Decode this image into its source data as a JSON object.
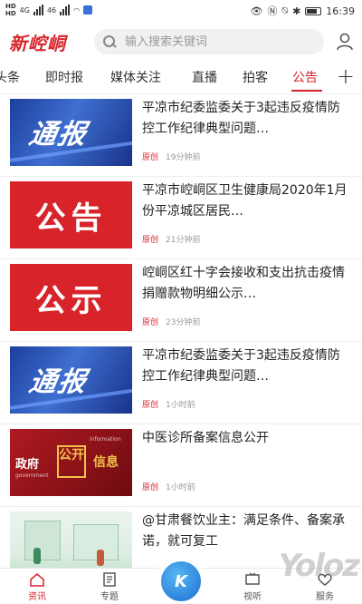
{
  "status_bar": {
    "left_labels": [
      "HD",
      "HD",
      "4G",
      "46"
    ],
    "time": "16:39",
    "battery_color": "#333333",
    "box_color": "#3b6fd6"
  },
  "header": {
    "logo": "新崆峒",
    "search_placeholder": "输入搜索关键词",
    "user_icon": "user-icon"
  },
  "tabs": [
    {
      "label": "头条",
      "active": false
    },
    {
      "label": "即时报",
      "active": false
    },
    {
      "label": "媒体关注",
      "active": false
    },
    {
      "label": "直播",
      "active": false
    },
    {
      "label": "拍客",
      "active": false
    },
    {
      "label": "公告",
      "active": true
    }
  ],
  "tabs_plus": "+",
  "accent_color": "#d8232a",
  "feed": [
    {
      "thumb": "通报",
      "title": "平凉市纪委监委关于3起违反疫情防控工作纪律典型问题…",
      "tag": "原创",
      "time": "19分钟前"
    },
    {
      "thumb": "公告",
      "title": "平凉市崆峒区卫生健康局2020年1月份平凉城区居民…",
      "tag": "原创",
      "time": "21分钟前"
    },
    {
      "thumb": "公示",
      "title": "崆峒区红十字会接收和支出抗击疫情捐赠款物明细公示…",
      "tag": "原创",
      "time": "23分钟前"
    },
    {
      "thumb": "通报",
      "title": "平凉市纪委监委关于3起违反疫情防控工作纪律典型问题…",
      "tag": "原创",
      "time": "1小时前"
    },
    {
      "thumb_labels": {
        "left": "政府",
        "mid": "公开",
        "right": "信息",
        "top": "information",
        "bottom": "government"
      },
      "title": "中医诊所备案信息公开",
      "tag": "原创",
      "time": "1小时前"
    },
    {
      "title": "@甘肃餐饮业主：满足条件、备案承诺，就可复工",
      "tag": "",
      "time": ""
    }
  ],
  "bottom_nav": [
    {
      "label": "资讯",
      "active": true
    },
    {
      "label": "专题",
      "active": false
    },
    {
      "label": "视听",
      "active": false
    },
    {
      "label": "服务",
      "active": false
    }
  ],
  "nav_center_label": "K",
  "watermark": "Yoloz"
}
